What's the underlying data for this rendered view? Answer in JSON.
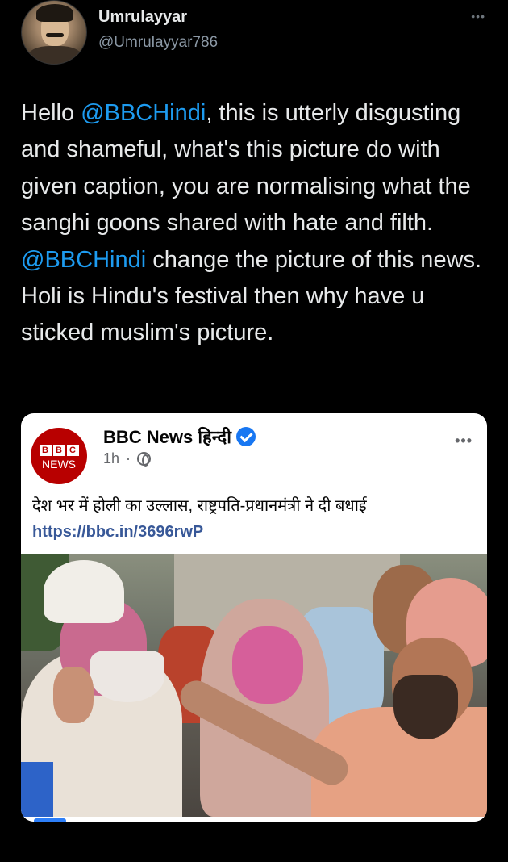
{
  "tweet": {
    "display_name": "Umrulayyar",
    "handle": "@Umrulayyar786",
    "more_label": "•••",
    "text_parts": [
      {
        "text": "Hello ",
        "kind": "plain"
      },
      {
        "text": "@BBCHindi",
        "kind": "mention"
      },
      {
        "text": ", this is utterly disgusting and shameful, what's this picture do with given caption, you are normalising what the sanghi goons shared with hate and filth. ",
        "kind": "plain"
      },
      {
        "text": "@BBCHindi",
        "kind": "mention"
      },
      {
        "text": " change the picture of this news. Holi is Hindu's festival then why have u sticked muslim's picture.",
        "kind": "plain"
      }
    ],
    "colors": {
      "background": "#000000",
      "text": "#e7e9ea",
      "mention": "#1d9bf0",
      "muted": "#8b98a5"
    }
  },
  "embedded_post": {
    "page_name": "BBC News हिन्दी",
    "logo_letters": [
      "B",
      "B",
      "C"
    ],
    "logo_word": "NEWS",
    "time": "1h",
    "separator": "·",
    "visibility_icon": "globe-icon",
    "more_label": "•••",
    "text": "देश भर में होली का उल्लास, राष्ट्रपति-प्रधानमंत्री ने दी बधाई",
    "link": "https://bbc.in/3696rwP",
    "colors": {
      "logo": "#b80000",
      "link": "#385898",
      "verified": "#1877f2"
    }
  }
}
